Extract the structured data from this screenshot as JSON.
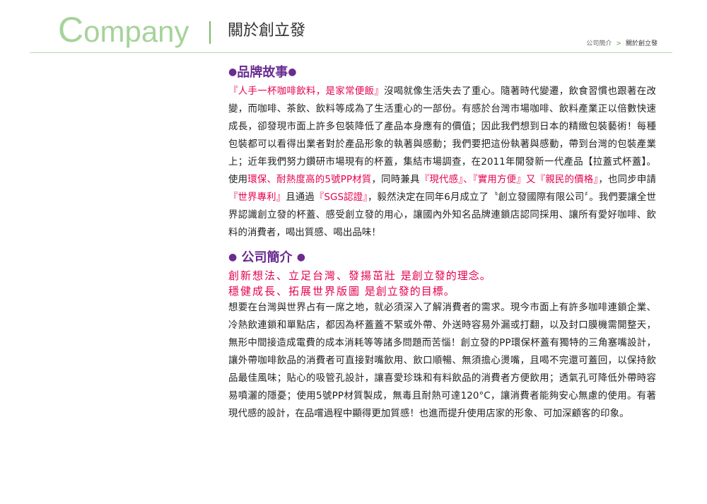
{
  "header": {
    "company_first": "C",
    "company_rest": "ompany",
    "page_title": "關於創立發",
    "breadcrumb": {
      "parent": "公司簡介",
      "separator": ">",
      "current": "關於創立發"
    }
  },
  "brand_story": {
    "title": "品牌故事",
    "dot": "●",
    "segments": [
      {
        "text": "『人手一杯咖啡飲料，是家常便飯』",
        "red": true
      },
      {
        "text": "沒喝就像生活失去了重心。隨著時代變遷，飲食習慣也跟著在改變，而咖啡、茶飲、飲料等成為了生活重心的一部份。有感於台灣市場咖啡、飲料產業正以倍數快速成長，卻發現市面上許多包裝降低了產品本身應有的價值；因此我們想到日本的精緻包裝藝術！每種包裝都可以看得出業者對於產品形象的執著與感動；我們要把這份執著與感動，帶到台灣的包裝產業上；近年我們努力鑽研市場現有的杯蓋，集結市場調查，在2011年開發新一代產品【拉蓋式杯蓋】。使用",
        "red": false
      },
      {
        "text": "環保、耐熱度高的5號PP材質",
        "red": true
      },
      {
        "text": "，同時兼具",
        "red": false
      },
      {
        "text": "『現代感』、『實用方便』又『親民的價格』",
        "red": true
      },
      {
        "text": "，也同步申請",
        "red": false
      },
      {
        "text": "『世界專利』",
        "red": true
      },
      {
        "text": "且通過",
        "red": false
      },
      {
        "text": "『SGS認證』",
        "red": true
      },
      {
        "text": "，毅然決定在同年6月成立了〝創立發國際有限公司〞。我們要讓全世界認識創立發的杯蓋、感受創立發的用心，讓國內外知名品牌連鎖店認同採用、讓所有愛好咖啡、飲料的消費者，喝出質感、喝出品味！",
        "red": false
      }
    ]
  },
  "company_intro": {
    "title": "公司簡介",
    "dot": "●",
    "slogan1_red": "創新想法、立足台灣、發揚茁壯",
    "slogan1_rest": " 是創立發的理念。",
    "slogan2_red": "穩健成長、拓展世界版圖",
    "slogan2_rest": " 是創立發的目標。",
    "body": "想要在台灣與世界占有一席之地，就必須深入了解消費者的需求。現今市面上有許多咖啡連鎖企業、冷熱飲連鎖和單點店，都因為杯蓋蓋不緊或外帶、外送時容易外漏或打翻，以及封口膜機需開整天，無形中間接造成電費的成本消耗等等諸多問題而苦惱！創立發的PP環保杯蓋有獨特的三角塞嘴設計，讓外帶咖啡飲品的消費者可直接對嘴飲用、飲口順暢、無須擔心燙嘴，且喝不完還可蓋回，以保持飲品最佳風味；貼心的吸管孔設計，讓喜愛珍珠和有料飲品的消費者方便飲用；透氣孔可降低外帶時容易噴灑的隱憂；使用5號PP材質製成，無毒且耐熱可達120°C，讓消費者能夠安心無慮的使用。有著現代感的設計，在品嚐過程中顯得更加質感！也進而提升使用店家的形象、可加深顧客的印象。"
  },
  "colors": {
    "accent_green": "#a6d39a",
    "purple": "#6a2c91",
    "red": "#e5004f"
  }
}
